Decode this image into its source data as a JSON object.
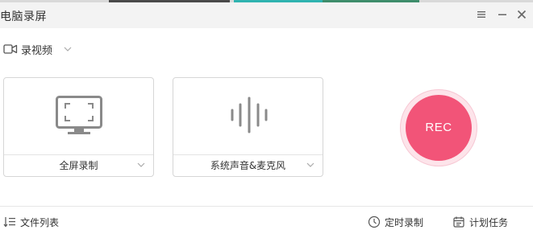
{
  "window": {
    "title": "电脑录屏",
    "accent_color": "#f25478"
  },
  "mode_selector": {
    "label": "录视频"
  },
  "cards": [
    {
      "label": "全屏录制"
    },
    {
      "label": "系统声音&麦克风"
    }
  ],
  "record_button": {
    "label": "REC"
  },
  "footer": {
    "file_list": "文件列表",
    "timed_record": "定时录制",
    "scheduled_tasks": "计划任务"
  }
}
